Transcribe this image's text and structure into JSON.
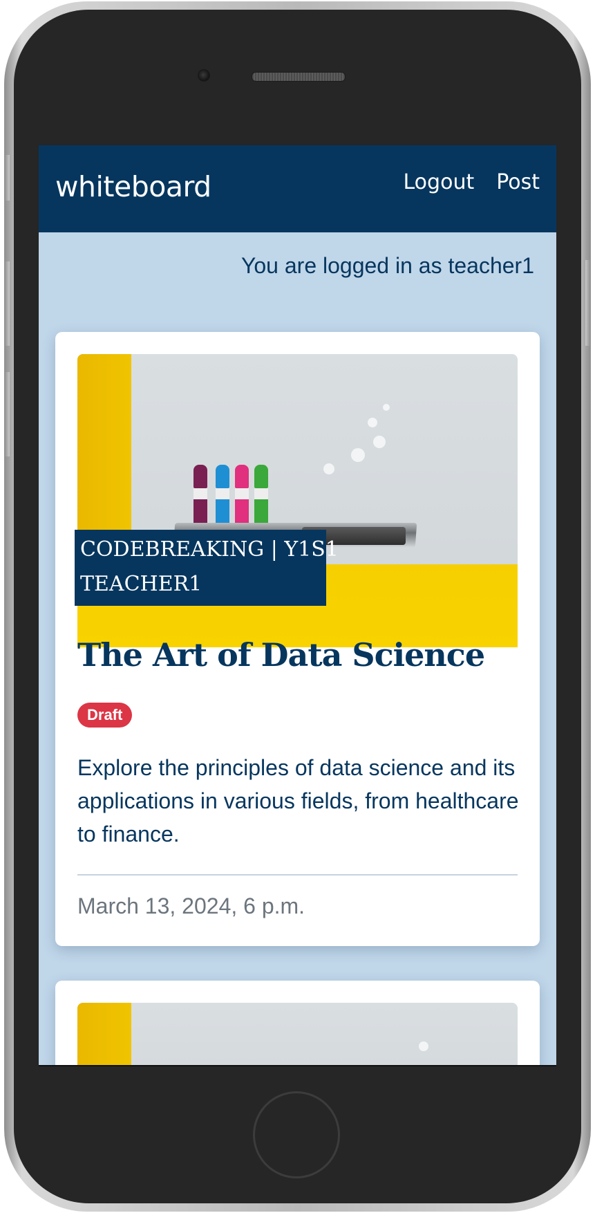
{
  "navbar": {
    "brand": "whiteboard",
    "links": [
      {
        "label": "Logout"
      },
      {
        "label": "Post"
      }
    ]
  },
  "login_status": "You are logged in as teacher1",
  "posts": [
    {
      "category": "CODEBREAKING | Y1S1",
      "author": "TEACHER1",
      "title": "The Art of Data Science",
      "status": "Draft",
      "summary": "Explore the principles of data science and its applications in various fields, from healthcare to finance.",
      "date": "March 13, 2024, 6 p.m."
    }
  ],
  "colors": {
    "navbar_bg": "#06365e",
    "page_bg": "#c0d6e9",
    "badge_draft": "#dc3545",
    "date_text": "#6c757d"
  }
}
